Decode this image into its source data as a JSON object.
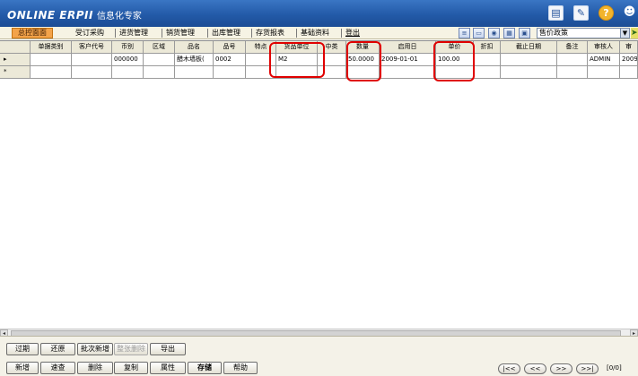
{
  "app": {
    "brand_en": "ONLINE ERPII",
    "brand_cn": "信息化专家"
  },
  "menu": {
    "items": [
      {
        "label": "总控面面"
      },
      {
        "label": "受订采购"
      },
      {
        "label": "进货管理"
      },
      {
        "label": "销货管理"
      },
      {
        "label": "出库管理"
      },
      {
        "label": "存货报表"
      },
      {
        "label": "基础资料"
      },
      {
        "label": "登出"
      }
    ],
    "policy_value": "售价政策"
  },
  "grid": {
    "columns": [
      "单据类别",
      "客户代号",
      "币别",
      "区域",
      "品名",
      "品号",
      "特点",
      "货品单位",
      "中类",
      "数量",
      "启用日",
      "单价",
      "折扣",
      "截止日期",
      "备注",
      "审核人",
      "审"
    ],
    "rows": [
      {
        "marker": "▸",
        "cells": [
          "",
          "",
          "000000",
          "",
          "醋木墙板(",
          "0002",
          "",
          "M2",
          "",
          "50.0000",
          "2009-01-01",
          "100.00",
          "",
          "",
          "",
          "ADMIN",
          "2009-0"
        ]
      }
    ],
    "new_row_marker": "*"
  },
  "buttons": {
    "row1": [
      {
        "label": "过期",
        "disabled": false
      },
      {
        "label": "还原",
        "disabled": false
      },
      {
        "label": "批次新增",
        "disabled": false
      },
      {
        "label": "整张删除",
        "disabled": true
      },
      {
        "label": "导出",
        "disabled": false
      }
    ],
    "row2": [
      {
        "label": "新增"
      },
      {
        "label": "速查"
      },
      {
        "label": "删除"
      },
      {
        "label": "复制"
      },
      {
        "label": "属性"
      },
      {
        "label": "存储"
      },
      {
        "label": "帮助"
      }
    ]
  },
  "pager": {
    "first": "|<<",
    "prev": "<<",
    "next": ">>",
    "last": ">>|",
    "status": "[0/0]"
  },
  "colors": {
    "title_bar": "#235aa8",
    "active_menu": "#f3a34a",
    "highlight": "#e00000"
  }
}
